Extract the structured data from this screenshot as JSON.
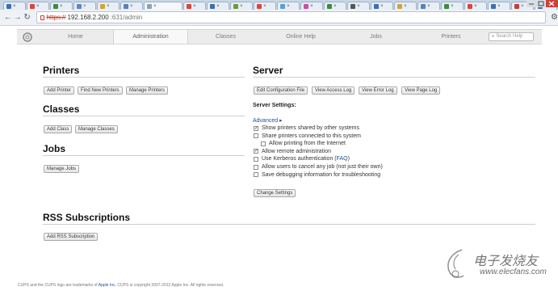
{
  "browser": {
    "tab_count": 23,
    "active_tab_index": 6,
    "address": {
      "scheme": "https://",
      "host": "192.168.2.200",
      "path": ":631/admin"
    },
    "tab_colors": [
      "#3b6fb0",
      "#d9463a",
      "#3f8a3b",
      "#5a89c7",
      "#d0a43a",
      "#5c7fb8",
      "#8ca0b8",
      "#d9463a",
      "#3b6fb0",
      "#6a9c3b",
      "#d9463a",
      "#5aa0d6",
      "#c94fa0",
      "#3f8a3b",
      "#555555",
      "#3b6fb0",
      "#d0a43a",
      "#5c7fb8",
      "#3f8a3b",
      "#d9463a",
      "#3b6fb0",
      "#c04040",
      "#3b6fb0"
    ]
  },
  "nav": {
    "items": [
      "Home",
      "Administration",
      "Classes",
      "Online Help",
      "Jobs",
      "Printers"
    ],
    "active": "Administration",
    "search_placeholder": "Search Help"
  },
  "printers": {
    "heading": "Printers",
    "buttons": [
      "Add Printer",
      "Find New Printers",
      "Manage Printers"
    ]
  },
  "classes": {
    "heading": "Classes",
    "buttons": [
      "Add Class",
      "Manage Classes"
    ]
  },
  "jobs": {
    "heading": "Jobs",
    "buttons": [
      "Manage Jobs"
    ]
  },
  "server": {
    "heading": "Server",
    "buttons": [
      "Edit Configuration File",
      "View Access Log",
      "View Error Log",
      "View Page Log"
    ],
    "settings_label": "Server Settings:",
    "advanced_link": "Advanced ▸",
    "options": [
      {
        "label": "Show printers shared by other systems",
        "checked": true,
        "indent": false
      },
      {
        "label": "Share printers connected to this system",
        "checked": false,
        "indent": false
      },
      {
        "label": "Allow printing from the Internet",
        "checked": false,
        "indent": true
      },
      {
        "label": "Allow remote administration",
        "checked": true,
        "indent": false
      },
      {
        "label": "Use Kerberos authentication (",
        "link": "FAQ",
        "suffix": ")",
        "checked": false,
        "indent": false
      },
      {
        "label": "Allow users to cancel any job (not just their own)",
        "checked": false,
        "indent": false
      },
      {
        "label": "Save debugging information for troubleshooting",
        "checked": false,
        "indent": false
      }
    ],
    "change_button": "Change Settings"
  },
  "rss": {
    "heading": "RSS Subscriptions",
    "button": "Add RSS Subscription"
  },
  "footer": {
    "pre": "CUPS and the CUPS logo are trademarks of ",
    "link": "Apple Inc.",
    "post": " CUPS is copyright 2007-2012 Apple Inc. All rights reserved."
  },
  "watermark": {
    "title": "电子发烧友",
    "url": "www.elecfans.com"
  }
}
